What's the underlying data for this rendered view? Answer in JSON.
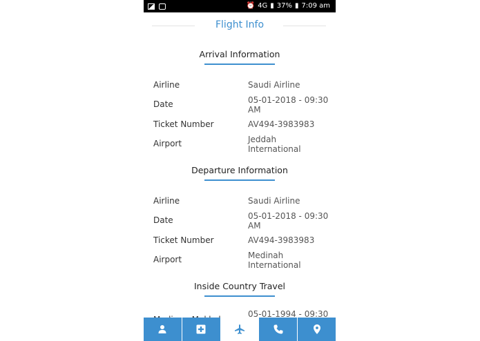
{
  "status": {
    "network": "4G",
    "battery": "37%",
    "time": "7:09 am"
  },
  "header": {
    "title": "Flight Info"
  },
  "arrival": {
    "heading": "Arrival Information",
    "rows": [
      {
        "label": "Airline",
        "value": "Saudi Airline"
      },
      {
        "label": "Date",
        "value": "05-01-2018 - 09:30 AM"
      },
      {
        "label": "Ticket Number",
        "value": "AV494-3983983"
      },
      {
        "label": "Airport",
        "value": "Jeddah International"
      }
    ]
  },
  "departure": {
    "heading": "Departure Information",
    "rows": [
      {
        "label": "Airline",
        "value": "Saudi Airline"
      },
      {
        "label": "Date",
        "value": "05-01-2018 - 09:30 AM"
      },
      {
        "label": "Ticket Number",
        "value": "AV494-3983983"
      },
      {
        "label": "Airport",
        "value": "Medinah International"
      }
    ]
  },
  "inside": {
    "heading": "Inside Country Travel",
    "rows": [
      {
        "label": "Medina - Makkah",
        "value": "05-01-1994 - 09:30"
      }
    ]
  },
  "tabs": [
    {
      "icon": "person-icon",
      "active": false
    },
    {
      "icon": "medical-cross-icon",
      "active": false
    },
    {
      "icon": "airplane-icon",
      "active": true
    },
    {
      "icon": "phone-icon",
      "active": false
    },
    {
      "icon": "location-pin-icon",
      "active": false
    }
  ],
  "colors": {
    "accent": "#3d8fcf",
    "statusbar": "#000000"
  }
}
